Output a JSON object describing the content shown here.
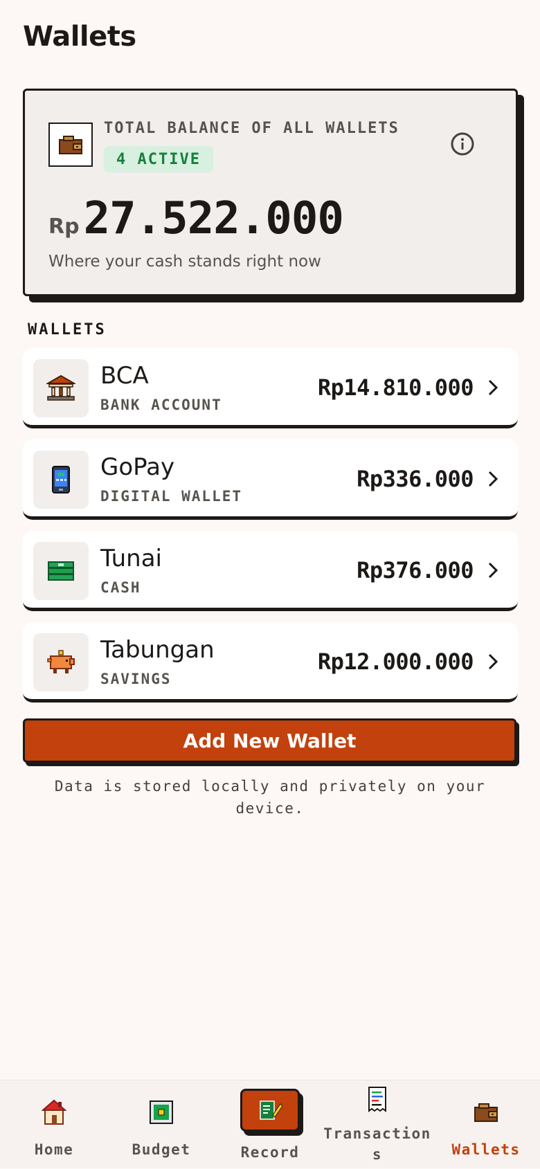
{
  "header": {
    "title": "Wallets"
  },
  "balance_card": {
    "label": "TOTAL BALANCE OF ALL WALLETS",
    "active_badge": "4 ACTIVE",
    "currency": "Rp",
    "amount": "27.522.000",
    "tagline": "Where your cash stands right now"
  },
  "section": {
    "label": "WALLETS"
  },
  "wallets": [
    {
      "name": "BCA",
      "type": "BANK ACCOUNT",
      "balance": "Rp14.810.000",
      "icon": "bank-icon"
    },
    {
      "name": "GoPay",
      "type": "DIGITAL WALLET",
      "balance": "Rp336.000",
      "icon": "phone-wallet-icon"
    },
    {
      "name": "Tunai",
      "type": "CASH",
      "balance": "Rp376.000",
      "icon": "cash-icon"
    },
    {
      "name": "Tabungan",
      "type": "SAVINGS",
      "balance": "Rp12.000.000",
      "icon": "piggy-bank-icon"
    }
  ],
  "actions": {
    "add_wallet": "Add New Wallet"
  },
  "footer_note": "Data is stored locally and privately on your device.",
  "nav": {
    "items": [
      {
        "label": "Home",
        "icon": "house-icon"
      },
      {
        "label": "Budget",
        "icon": "budget-icon"
      },
      {
        "label": "Record",
        "icon": "record-icon"
      },
      {
        "label": "Transactions",
        "icon": "receipt-icon"
      },
      {
        "label": "Wallets",
        "icon": "wallet-icon",
        "active": true
      }
    ]
  },
  "colors": {
    "accent": "#c2410c",
    "background": "#fdf8f5",
    "card": "#f1eeec",
    "badge_bg": "#d7f0df",
    "badge_text": "#15803d"
  }
}
